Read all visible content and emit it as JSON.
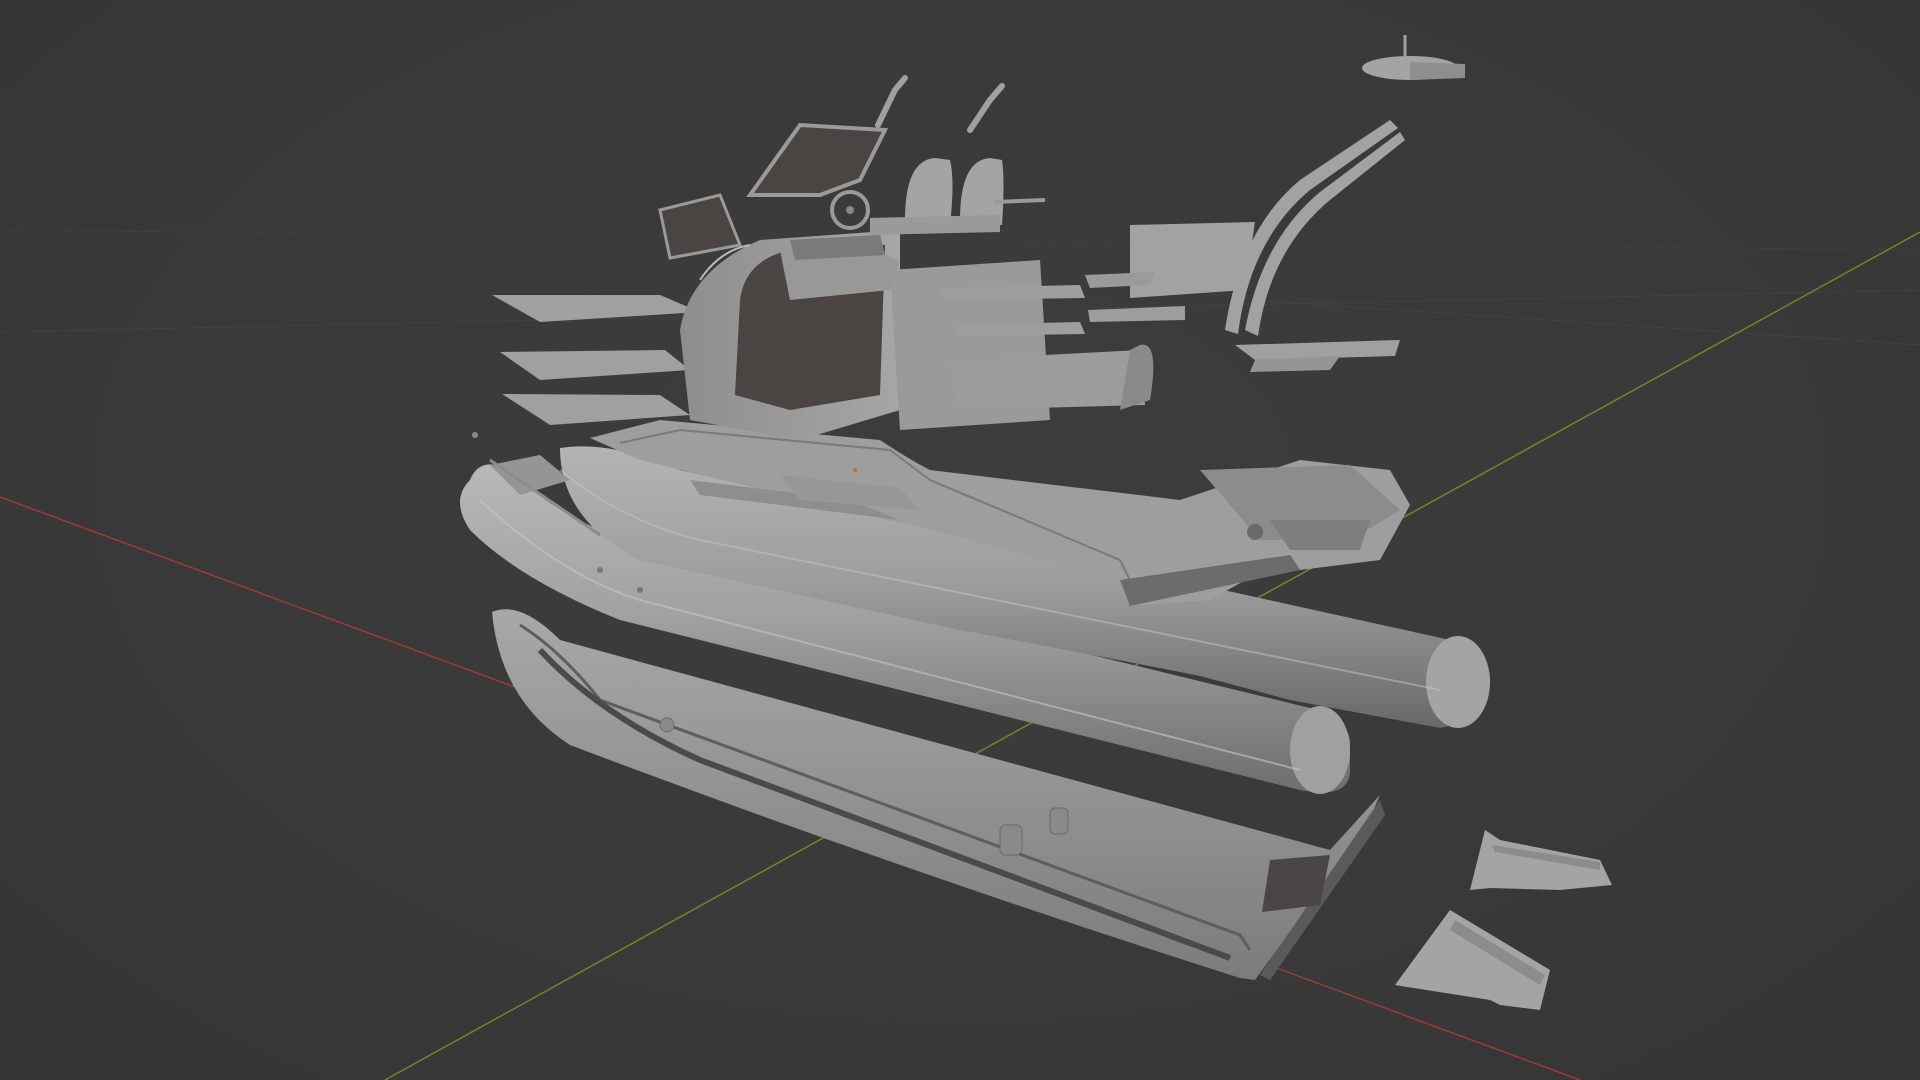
{
  "viewport": {
    "name": "3d-viewport",
    "mode": "solid-shading",
    "background_color": "#393939",
    "axis_colors": {
      "x_axis": "#9c3a3a",
      "y_axis": "#6a8a2a",
      "grid": "#434343"
    },
    "model": {
      "name": "exploded-rib-boat",
      "surface_color": "#9e9e9e",
      "parts": [
        "hull",
        "left-tube",
        "right-tube",
        "deck",
        "console",
        "windshield",
        "steering-wheel",
        "helm-seats",
        "grab-handles",
        "bow-seats",
        "rear-bench",
        "side-shelves",
        "t-top-arch",
        "radar-dome",
        "stern-platform",
        "swim-steps"
      ]
    }
  }
}
